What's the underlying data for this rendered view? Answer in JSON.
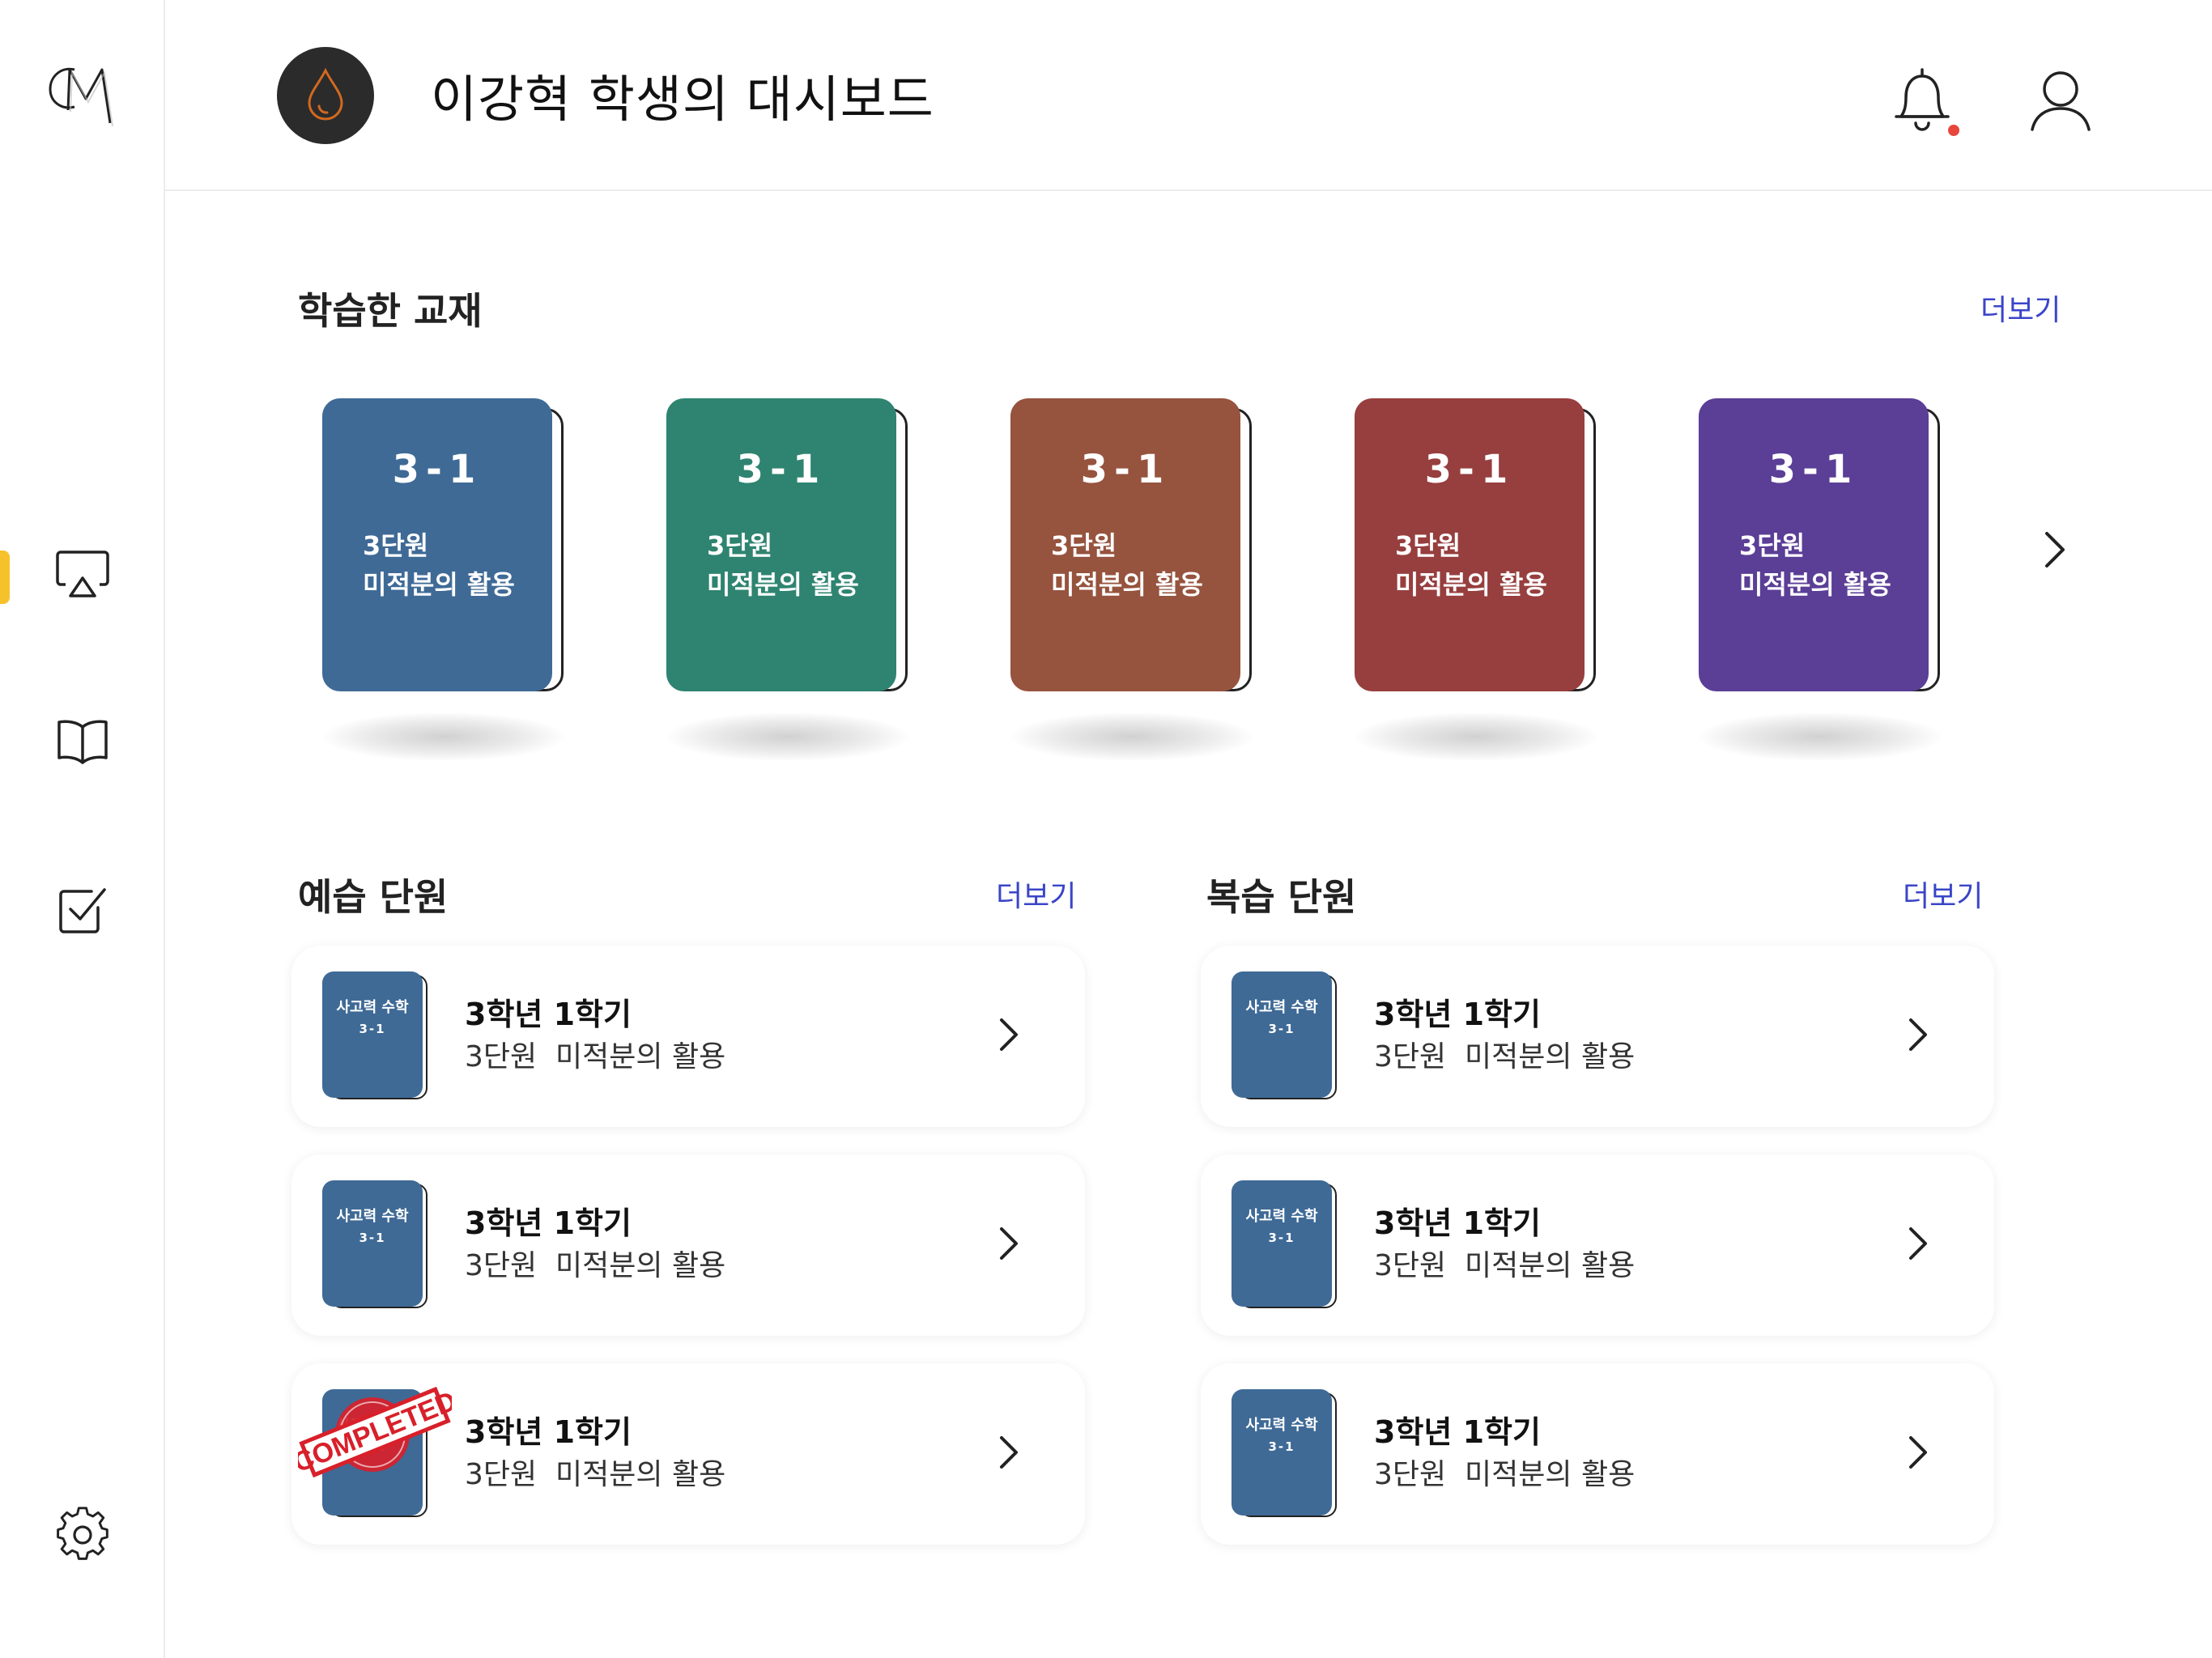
{
  "header": {
    "title": "이강혁 학생의 대시보드"
  },
  "sidebar": {
    "items": [
      {
        "icon": "airplay-icon",
        "active": true
      },
      {
        "icon": "book-icon",
        "active": false
      },
      {
        "icon": "checkbox-icon",
        "active": false
      },
      {
        "icon": "gear-icon",
        "active": false
      }
    ]
  },
  "textbooks": {
    "title": "학습한 교재",
    "more": "더보기",
    "books": [
      {
        "grade": "3-1",
        "unit": "3단원",
        "topic": "미적분의 활용",
        "color": "#3f6a96"
      },
      {
        "grade": "3-1",
        "unit": "3단원",
        "topic": "미적분의 활용",
        "color": "#2e8470"
      },
      {
        "grade": "3-1",
        "unit": "3단원",
        "topic": "미적분의 활용",
        "color": "#96533e"
      },
      {
        "grade": "3-1",
        "unit": "3단원",
        "topic": "미적분의 활용",
        "color": "#973e3e"
      },
      {
        "grade": "3-1",
        "unit": "3단원",
        "topic": "미적분의 활용",
        "color": "#5b3e96"
      }
    ]
  },
  "preview": {
    "title": "예습 단원",
    "more": "더보기",
    "cards": [
      {
        "book_title": "사고력 수학",
        "book_grade": "3-1",
        "grade": "3학년 1학기",
        "unit": "3단원  미적분의 활용",
        "completed": false
      },
      {
        "book_title": "사고력 수학",
        "book_grade": "3-1",
        "grade": "3학년 1학기",
        "unit": "3단원  미적분의 활용",
        "completed": false
      },
      {
        "book_title": "사고력 수학",
        "book_grade": "3-1",
        "grade": "3학년 1학기",
        "unit": "3단원  미적분의 활용",
        "completed": true
      }
    ]
  },
  "review": {
    "title": "복습 단원",
    "more": "더보기",
    "cards": [
      {
        "book_title": "사고력 수학",
        "book_grade": "3-1",
        "grade": "3학년 1학기",
        "unit": "3단원  미적분의 활용",
        "completed": false
      },
      {
        "book_title": "사고력 수학",
        "book_grade": "3-1",
        "grade": "3학년 1학기",
        "unit": "3단원  미적분의 활용",
        "completed": false
      },
      {
        "book_title": "사고력 수학",
        "book_grade": "3-1",
        "grade": "3학년 1학기",
        "unit": "3단원  미적분의 활용",
        "completed": false
      }
    ]
  },
  "stamp": {
    "label": "COMPLETED",
    "color": "#d8202a"
  },
  "colors": {
    "accent": "#f6c22b",
    "link": "#3a45c8",
    "notification": "#e8453c"
  }
}
